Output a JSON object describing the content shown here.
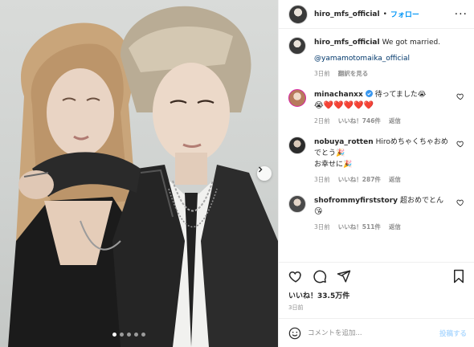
{
  "post": {
    "author": "hiro_mfs_official",
    "follow_label": "フォロー",
    "separator": "•",
    "more_icon": "more-horizontal-icon",
    "carousel": {
      "slide_count": 5,
      "active_index": 0,
      "next_icon": "chevron-right-icon"
    }
  },
  "caption": {
    "username": "hiro_mfs_official",
    "text": "We got married.",
    "mention": "@yamamotomaika_official",
    "time": "3日前",
    "translate_label": "翻訳を見る"
  },
  "comments": [
    {
      "username": "minachanxx",
      "verified": true,
      "line1": "待ってました😭",
      "line2": "😭❤️❤️❤️❤️❤️",
      "time": "2日前",
      "likes": "いいね！746件",
      "reply_label": "返信"
    },
    {
      "username": "nobuya_rotten",
      "verified": false,
      "line1": "Hiroめちゃくちゃおめでとう🎉",
      "line2": "お幸せに🎉",
      "time": "3日前",
      "likes": "いいね！287件",
      "reply_label": "返信"
    },
    {
      "username": "shofrommyfirststory",
      "verified": false,
      "line1": "超おめでとん",
      "line2": "😘",
      "time": "3日前",
      "likes": "いいね！511件",
      "reply_label": "返信"
    }
  ],
  "actions": {
    "icons": [
      "heart-icon",
      "comment-icon",
      "share-icon",
      "bookmark-icon"
    ],
    "likes": "いいね！33.5万件",
    "date": "3日前"
  },
  "composer": {
    "emoji_icon": "emoji-icon",
    "placeholder": "コメントを追加...",
    "post_label": "投稿する"
  },
  "colors": {
    "accent": "#0095f6",
    "post_disabled": "#b3dbff",
    "muted": "#8e8e8e",
    "verified": "#3897f0"
  }
}
